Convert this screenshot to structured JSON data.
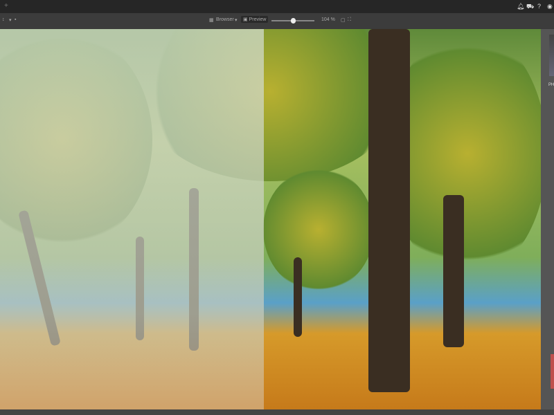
{
  "titlebar": {
    "add_icon": "+",
    "icons": [
      "bell-icon",
      "cart-icon",
      "help-icon",
      "user-icon"
    ],
    "help": "?"
  },
  "toolbar": {
    "sort_label": "↕",
    "browser_label": "Browser",
    "preview_label": "Preview",
    "zoom": "104 %"
  },
  "panel": {
    "label": "PH"
  },
  "colors": {
    "accent": "#c0504d"
  }
}
